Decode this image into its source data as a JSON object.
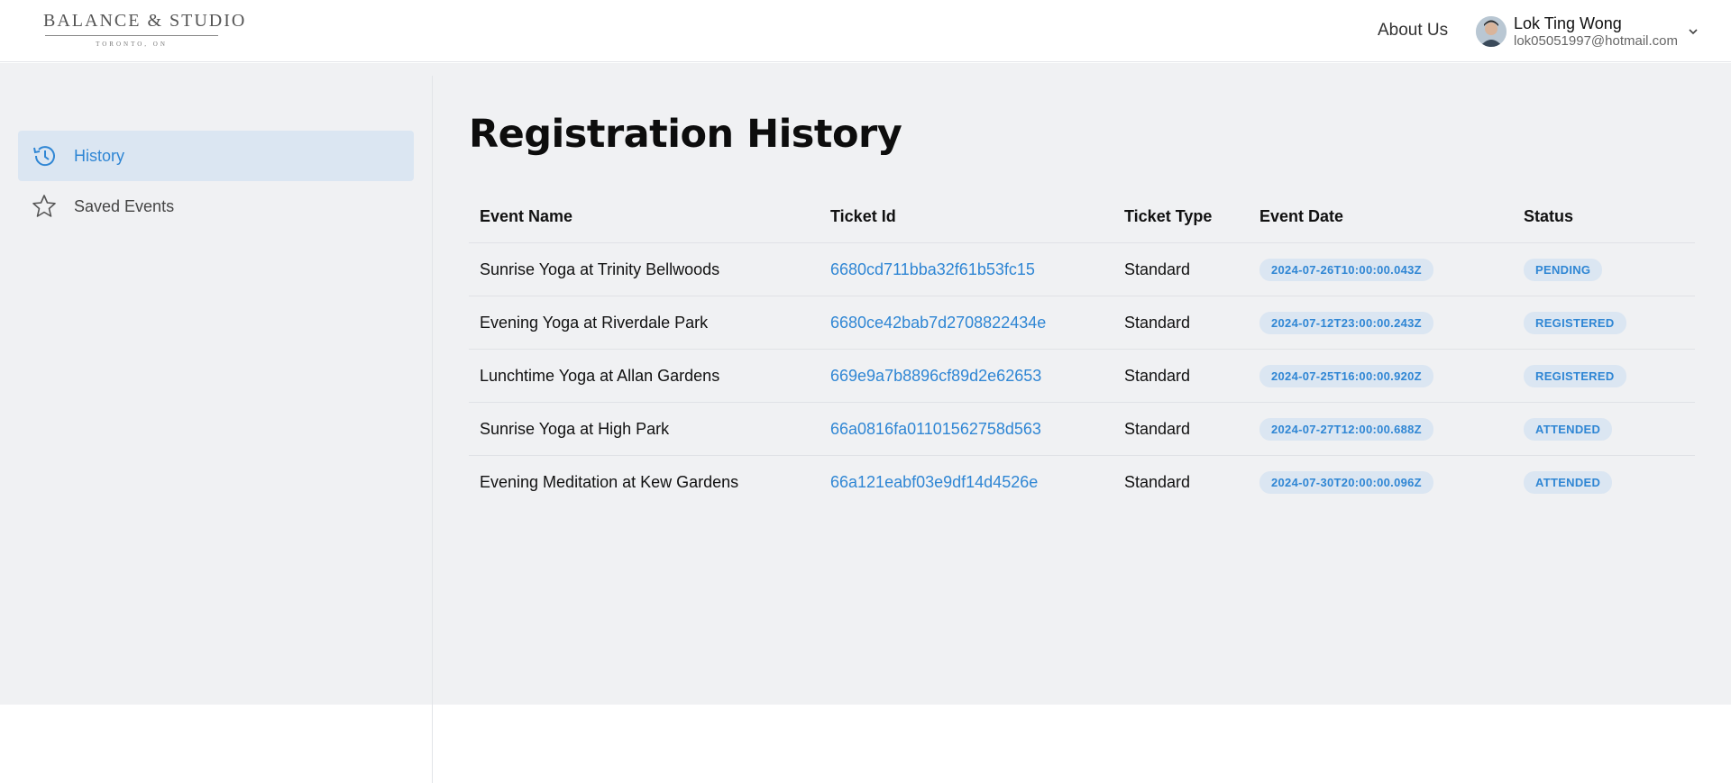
{
  "header": {
    "logo": {
      "main": "BALANCE & STUDIO",
      "sub": "TORONTO, ON"
    },
    "about_label": "About Us",
    "user": {
      "name": "Lok Ting Wong",
      "email": "lok05051997@hotmail.com"
    }
  },
  "sidebar": {
    "items": [
      {
        "label": "History",
        "icon": "history-icon",
        "active": true
      },
      {
        "label": "Saved Events",
        "icon": "star-icon",
        "active": false
      }
    ]
  },
  "main": {
    "title": "Registration History",
    "columns": [
      "Event Name",
      "Ticket Id",
      "Ticket Type",
      "Event Date",
      "Status"
    ],
    "rows": [
      {
        "event": "Sunrise Yoga at Trinity Bellwoods",
        "ticket_id": "6680cd711bba32f61b53fc15",
        "type": "Standard",
        "date": "2024-07-26T10:00:00.043Z",
        "status": "PENDING"
      },
      {
        "event": "Evening Yoga at Riverdale Park",
        "ticket_id": "6680ce42bab7d2708822434e",
        "type": "Standard",
        "date": "2024-07-12T23:00:00.243Z",
        "status": "REGISTERED"
      },
      {
        "event": "Lunchtime Yoga at Allan Gardens",
        "ticket_id": "669e9a7b8896cf89d2e62653",
        "type": "Standard",
        "date": "2024-07-25T16:00:00.920Z",
        "status": "REGISTERED"
      },
      {
        "event": "Sunrise Yoga at High Park",
        "ticket_id": "66a0816fa01101562758d563",
        "type": "Standard",
        "date": "2024-07-27T12:00:00.688Z",
        "status": "ATTENDED"
      },
      {
        "event": "Evening Meditation at Kew Gardens",
        "ticket_id": "66a121eabf03e9df14d4526e",
        "type": "Standard",
        "date": "2024-07-30T20:00:00.096Z",
        "status": "ATTENDED"
      }
    ]
  },
  "colors": {
    "accent": "#2f86d4",
    "badge_bg": "#dbe6f2",
    "band_bg": "#f0f1f3"
  }
}
